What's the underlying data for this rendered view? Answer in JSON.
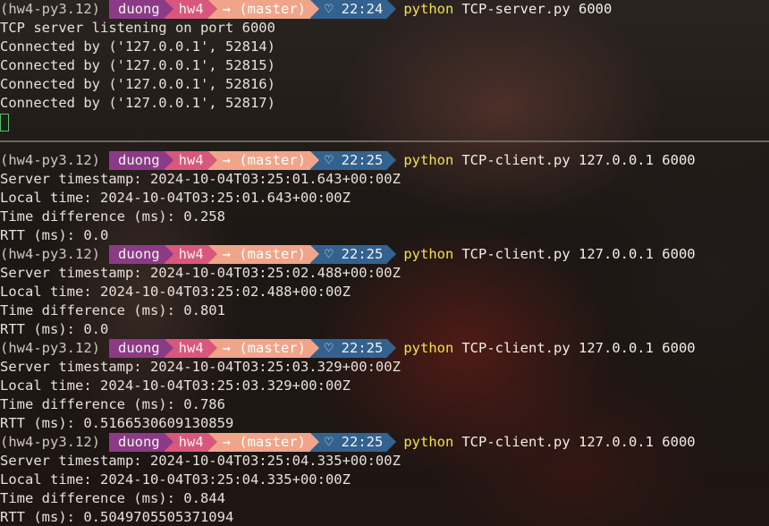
{
  "prompt": {
    "venv": "(hw4-py3.12)",
    "user": "duong",
    "dir": "hw4",
    "git": "→ (master)",
    "heart": "♡"
  },
  "server": {
    "time": "22:24",
    "python": "python",
    "command": "TCP-server.py 6000",
    "output": [
      "TCP server listening on port 6000",
      "Connected by ('127.0.0.1', 52814)",
      "Connected by ('127.0.0.1', 52815)",
      "Connected by ('127.0.0.1', 52816)",
      "Connected by ('127.0.0.1', 52817)"
    ]
  },
  "client": {
    "python": "python",
    "command": "TCP-client.py 127.0.0.1 6000",
    "runs": [
      {
        "time": "22:25",
        "output": [
          "Server timestamp: 2024-10-04T03:25:01.643+00:00Z",
          "Local time: 2024-10-04T03:25:01.643+00:00Z",
          "Time difference (ms): 0.258",
          "RTT (ms): 0.0"
        ]
      },
      {
        "time": "22:25",
        "output": [
          "Server timestamp: 2024-10-04T03:25:02.488+00:00Z",
          "Local time: 2024-10-04T03:25:02.488+00:00Z",
          "Time difference (ms): 0.801",
          "RTT (ms): 0.0"
        ]
      },
      {
        "time": "22:25",
        "output": [
          "Server timestamp: 2024-10-04T03:25:03.329+00:00Z",
          "Local time: 2024-10-04T03:25:03.329+00:00Z",
          "Time difference (ms): 0.786",
          "RTT (ms): 0.5166530609130859"
        ]
      },
      {
        "time": "22:25",
        "output": [
          "Server timestamp: 2024-10-04T03:25:04.335+00:00Z",
          "Local time: 2024-10-04T03:25:04.335+00:00Z",
          "Time difference (ms): 0.844",
          "RTT (ms): 0.5049705505371094"
        ]
      }
    ]
  },
  "colors": {
    "user_segment": "#8b3b86",
    "dir_segment": "#d9577d",
    "git_segment": "#f0a58a",
    "time_segment": "#33628f",
    "python_keyword": "#f4e04d",
    "cursor": "#56c26a"
  },
  "icons": {
    "heart": "heart-icon",
    "git_arrow": "git-arrow-icon",
    "cursor": "block-cursor-icon"
  }
}
